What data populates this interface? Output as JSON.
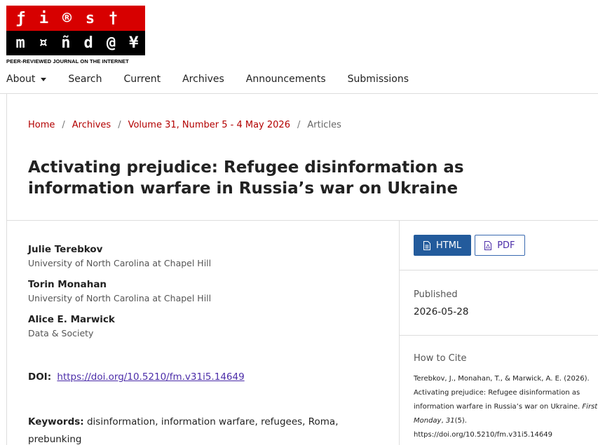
{
  "logo": {
    "row1": [
      "ƒ",
      "i",
      "®",
      "s",
      "†"
    ],
    "row2": [
      "m",
      "¤",
      "ñ",
      "d",
      "@",
      "¥"
    ],
    "tagline": "PEER-REVIEWED JOURNAL ON THE INTERNET",
    "colors": {
      "red": "#d70000",
      "black": "#000000"
    }
  },
  "nav": {
    "about": "About",
    "search": "Search",
    "current": "Current",
    "archives": "Archives",
    "announcements": "Announcements",
    "submissions": "Submissions"
  },
  "breadcrumb": {
    "home": "Home",
    "archives": "Archives",
    "issue": "Volume 31, Number 5 - 4 May 2026",
    "current": "Articles",
    "separator": "/"
  },
  "article": {
    "title": "Activating prejudice: Refugee disinformation as information warfare in Russia’s war on Ukraine",
    "authors": [
      {
        "name": "Julie Terebkov",
        "affiliation": "University of North Carolina at Chapel Hill"
      },
      {
        "name": "Torin Monahan",
        "affiliation": "University of North Carolina at Chapel Hill"
      },
      {
        "name": "Alice E. Marwick",
        "affiliation": "Data & Society"
      }
    ],
    "doi_label": "DOI:",
    "doi_url": "https://doi.org/10.5210/fm.v31i5.14649",
    "keywords_label": "Keywords:",
    "keywords": "disinformation, information warfare, refugees, Roma, prebunking"
  },
  "sidebar": {
    "html_button": "HTML",
    "pdf_button": "PDF",
    "published_label": "Published",
    "published_date": "2026-05-28",
    "cite_label": "How to Cite",
    "cite_pre": "Terebkov, J., Monahan, T., & Marwick, A. E. (2026). Activating prejudice: Refugee disinformation as information warfare in Russia’s war on Ukraine. ",
    "cite_journal": "First Monday",
    "cite_sep": ", ",
    "cite_volume": "31",
    "cite_post": "(5). https://doi.org/10.5210/fm.v31i5.14649"
  },
  "colors": {
    "link_red": "#b30000",
    "link_purple": "#4b2ca8",
    "button_blue": "#235b9c"
  }
}
